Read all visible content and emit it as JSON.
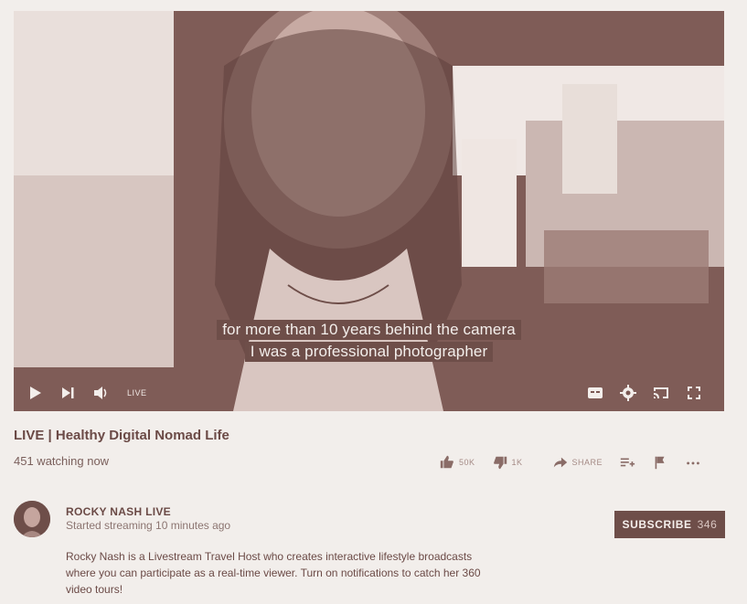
{
  "video": {
    "captions": [
      "for more than 10 years behind the camera",
      "I was a professional photographer"
    ],
    "live_badge": "LIVE"
  },
  "title": "LIVE | Healthy Digital Nomad Life",
  "watching": "451 watching now",
  "actions": {
    "like": "50K",
    "dislike": "1K",
    "share": "SHARE"
  },
  "channel": {
    "name": "ROCKY NASH LIVE",
    "status": "Started streaming 10 minutes ago",
    "subscribe_label": "SUBSCRIBE",
    "subscriber_count": "346"
  },
  "description": "Rocky Nash is a Livestream Travel Host who creates interactive lifestyle broadcasts where you can participate as a real-time viewer. Turn on notifications to catch her 360 video tours!",
  "colors": {
    "accent": "#6e4e49",
    "background": "#f2eeeb"
  }
}
